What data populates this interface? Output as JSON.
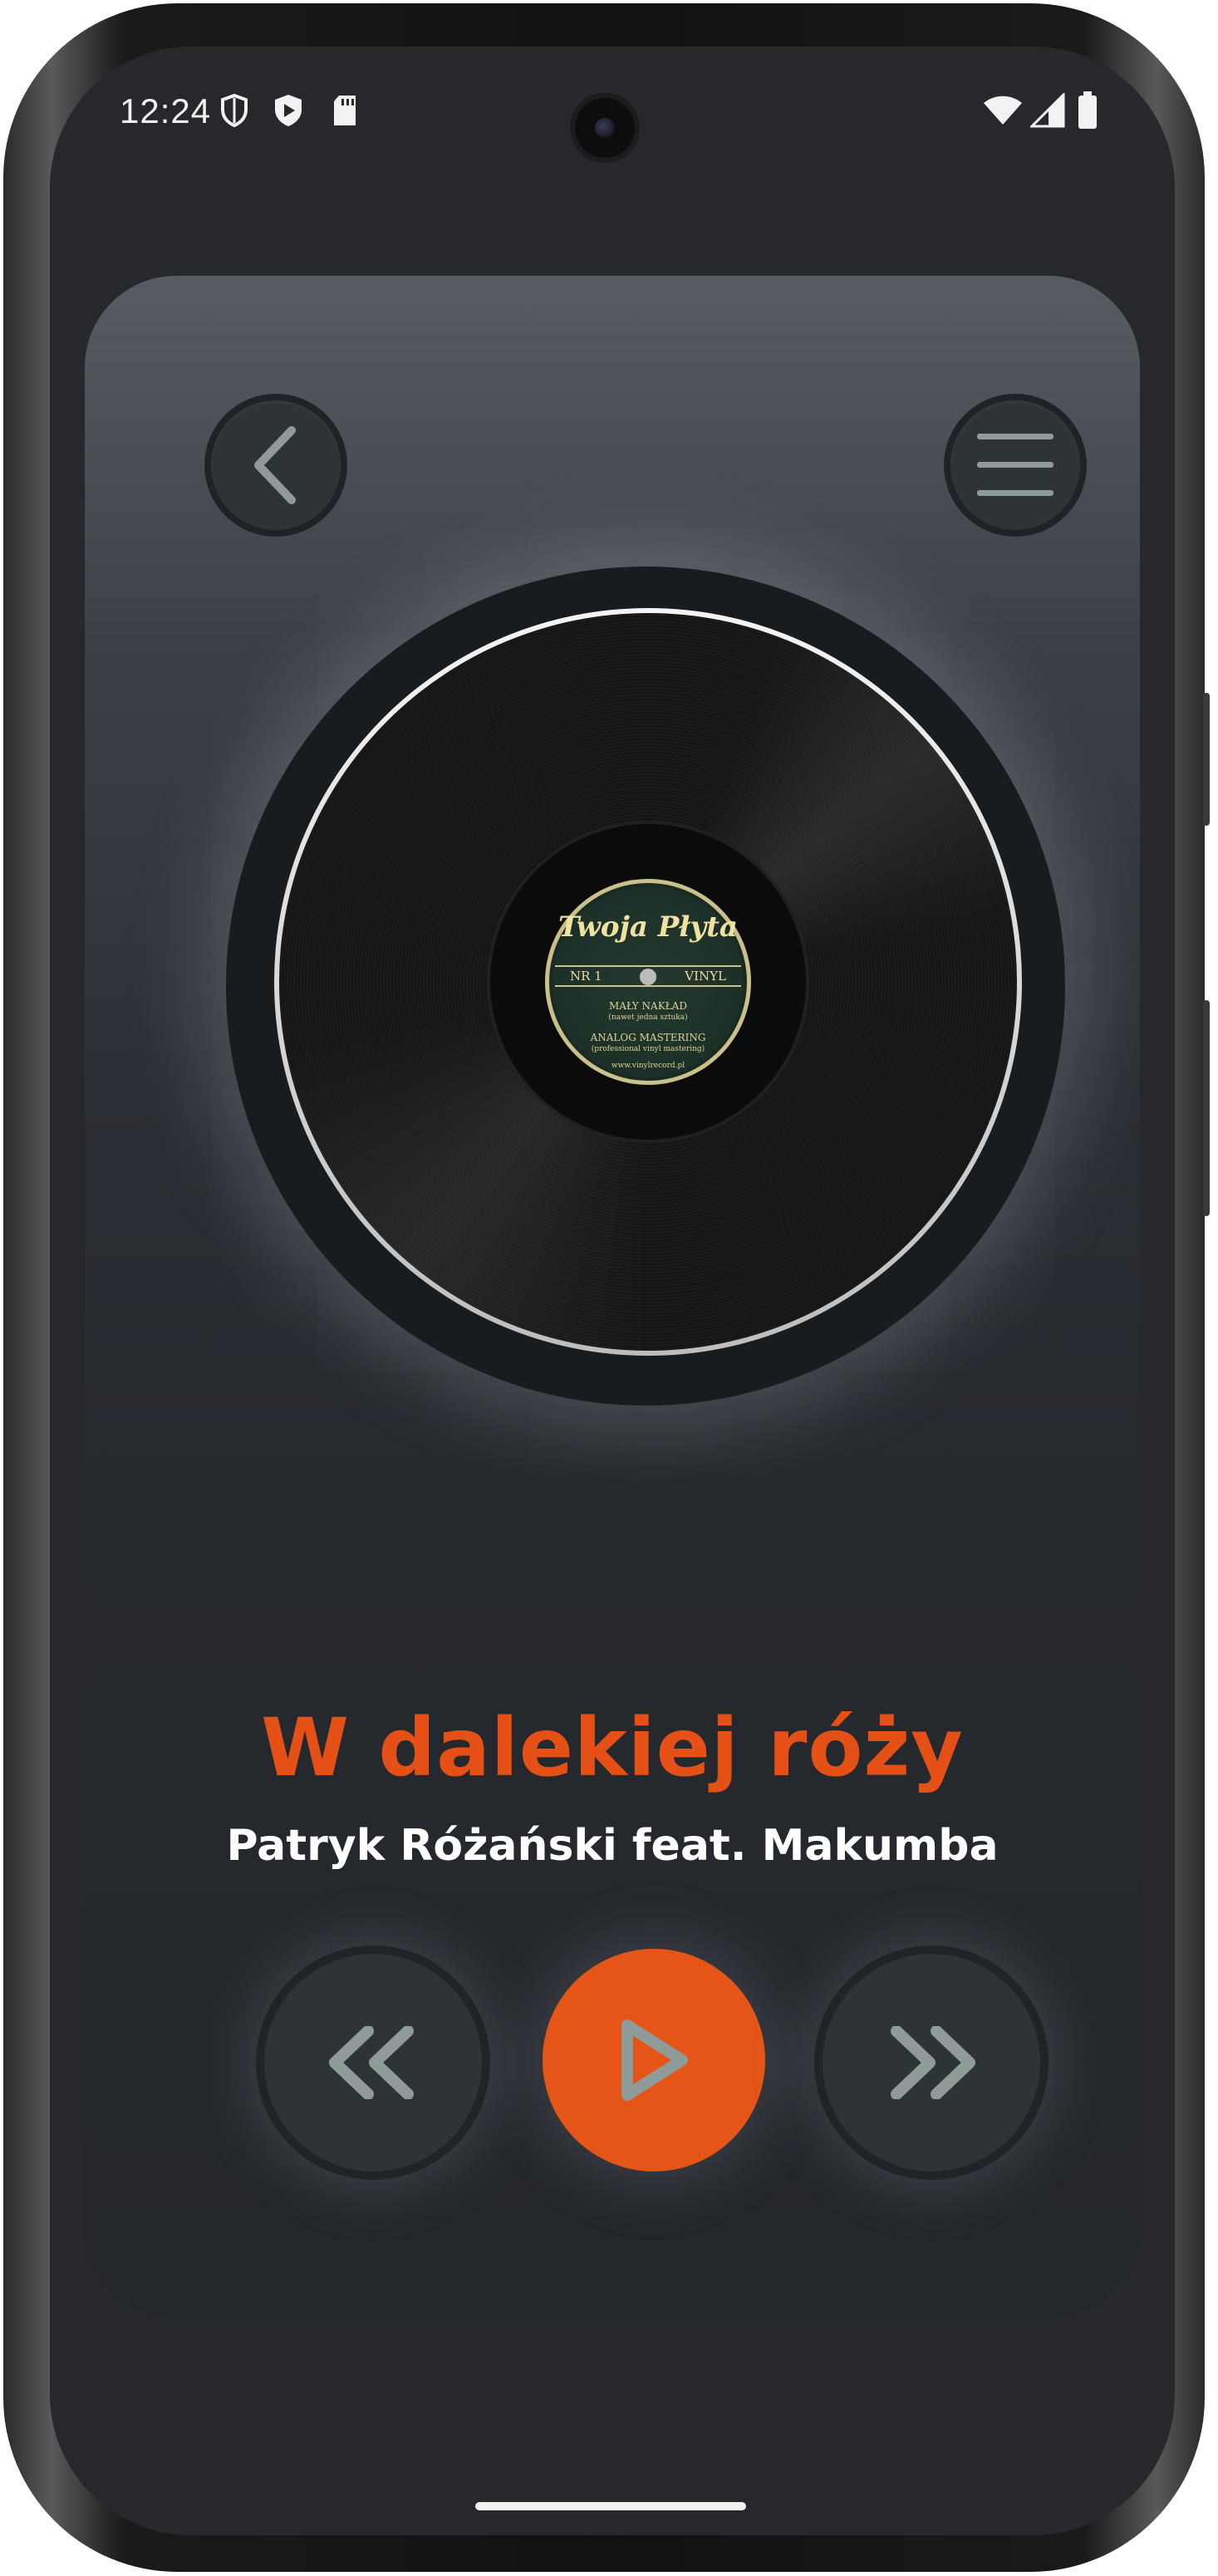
{
  "status_bar": {
    "time": "12:24",
    "left_icons": [
      "shield-outline-icon",
      "play-shield-icon",
      "sd-card-icon"
    ],
    "right_icons": [
      "wifi-icon",
      "signal-icon",
      "battery-icon"
    ]
  },
  "player": {
    "back_icon": "chevron-left-icon",
    "menu_icon": "hamburger-menu-icon",
    "record_label": {
      "brand": "Twoja Płyta",
      "left_band": "NR 1",
      "right_band": "VINYL",
      "line1": "MAŁY NAKŁAD",
      "line1_sub": "(nawet jedna sztuka)",
      "line2": "ANALOG MASTERING",
      "line2_sub": "(professional vinyl mastering)",
      "url": "www.vinylrecord.pl"
    },
    "song_title": "W dalekiej róży",
    "artist": "Patryk Różański feat. Makumba",
    "controls": {
      "rewind_icon": "double-chevron-left-icon",
      "play_icon": "play-triangle-icon",
      "forward_icon": "double-chevron-right-icon"
    }
  },
  "colors": {
    "accent": "#e55016",
    "background": "#26282b",
    "icon": "#8e9b98"
  }
}
